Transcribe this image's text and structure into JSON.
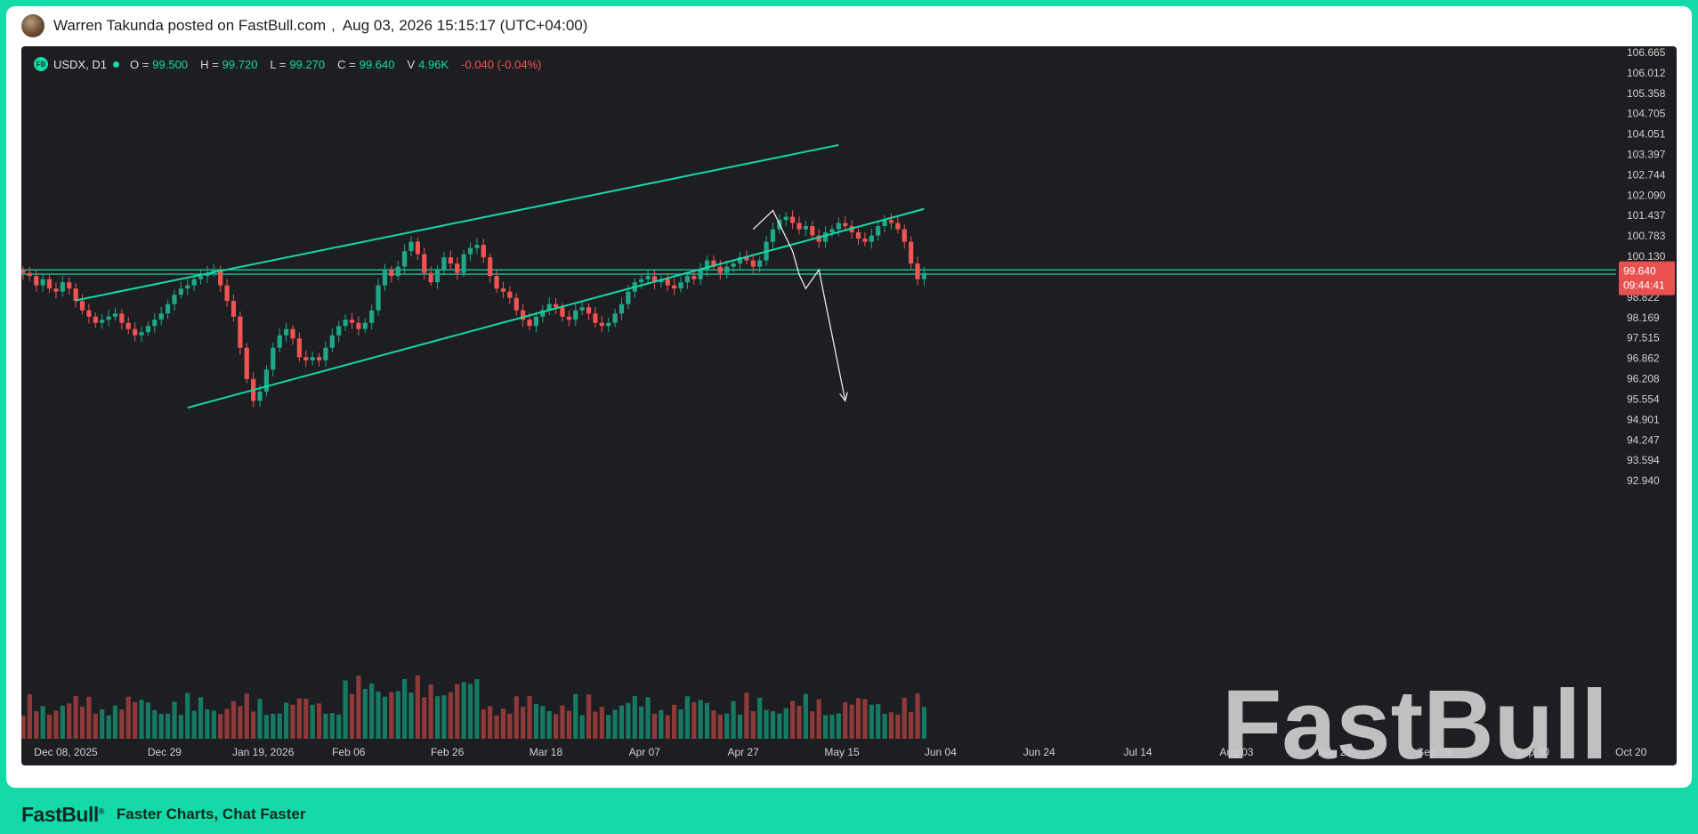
{
  "header": {
    "author": "Warren Takunda posted on FastBull.com",
    "separator": ",",
    "timestamp": "Aug 03, 2026 15:15:17 (UTC+04:00)"
  },
  "legend": {
    "badge": "FB",
    "symbol": "USDX, D1",
    "o_label": "O =",
    "o_value": "99.500",
    "h_label": "H =",
    "h_value": "99.720",
    "l_label": "L =",
    "l_value": "99.270",
    "c_label": "C =",
    "c_value": "99.640",
    "v_label": "V",
    "v_value": "4.96K",
    "change": "-0.040 (-0.04%)"
  },
  "footer": {
    "brand": "FastBull",
    "registered": "®",
    "tagline": "Faster Charts, Chat Faster"
  },
  "watermark": "FastBull",
  "colors": {
    "accent": "#14d9a8",
    "up": "#1fa888",
    "down": "#f05454",
    "background": "#1d1e21"
  },
  "chart_data": {
    "type": "candlestick",
    "title": "USDX, D1",
    "ylim": [
      92.4,
      106.9
    ],
    "y_ticks": [
      "106.665",
      "106.012",
      "105.358",
      "104.705",
      "104.051",
      "103.397",
      "102.744",
      "102.090",
      "101.437",
      "100.783",
      "100.130",
      "98.822",
      "98.169",
      "97.515",
      "96.862",
      "96.208",
      "95.554",
      "94.901",
      "94.247",
      "93.594",
      "92.940"
    ],
    "x_tick_labels": [
      "Dec 08, 2025",
      "Dec 29",
      "Jan 19, 2026",
      "Feb 06",
      "Feb 26",
      "Mar 18",
      "Apr 07",
      "Apr 27",
      "May 15",
      "Jun 04",
      "Jun 24",
      "Jul 14",
      "Aug 03",
      "Aug 21",
      "Sep 10",
      "Sep 30",
      "Oct 20"
    ],
    "x_tick_index": [
      0,
      15,
      30,
      43,
      58,
      73,
      88,
      103,
      118,
      133,
      148,
      163,
      178,
      193,
      208,
      223,
      238
    ],
    "closes": [
      99.6,
      99.5,
      99.2,
      99.4,
      99.1,
      99.0,
      99.3,
      99.1,
      98.7,
      98.4,
      98.2,
      98.0,
      98.1,
      98.2,
      98.3,
      98.0,
      97.8,
      97.6,
      97.7,
      97.9,
      98.1,
      98.3,
      98.6,
      98.9,
      99.1,
      99.2,
      99.4,
      99.5,
      99.6,
      99.7,
      99.2,
      98.7,
      98.2,
      97.2,
      96.2,
      95.5,
      95.8,
      96.5,
      97.2,
      97.6,
      97.8,
      97.5,
      96.9,
      96.8,
      96.9,
      96.8,
      97.2,
      97.6,
      97.9,
      98.1,
      98.0,
      97.8,
      98.0,
      98.4,
      99.2,
      99.7,
      99.5,
      99.8,
      100.3,
      100.6,
      100.2,
      99.6,
      99.3,
      99.7,
      100.1,
      99.9,
      99.6,
      100.2,
      100.4,
      100.5,
      100.1,
      99.5,
      99.1,
      99.0,
      98.8,
      98.4,
      98.1,
      97.9,
      98.2,
      98.4,
      98.6,
      98.5,
      98.2,
      98.1,
      98.4,
      98.5,
      98.3,
      98.0,
      97.9,
      98.0,
      98.3,
      98.6,
      99.0,
      99.3,
      99.4,
      99.5,
      99.3,
      99.4,
      99.2,
      99.1,
      99.3,
      99.5,
      99.4,
      99.7,
      100.0,
      99.8,
      99.6,
      99.8,
      99.9,
      100.1,
      100.0,
      99.8,
      100.0,
      100.6,
      101.0,
      101.3,
      101.4,
      101.2,
      101.0,
      101.1,
      100.8,
      100.6,
      100.9,
      101.0,
      101.2,
      101.1,
      100.9,
      100.7,
      100.6,
      100.8,
      101.1,
      101.3,
      101.2,
      101.0,
      100.6,
      99.9,
      99.4,
      99.6
    ],
    "channel_upper": [
      [
        8,
        98.72
      ],
      [
        90,
        101.6
      ],
      [
        124,
        103.7
      ]
    ],
    "channel_lower": [
      [
        25,
        95.28
      ],
      [
        118,
        100.8
      ],
      [
        137,
        101.65
      ]
    ],
    "horizontal_levels": [
      99.7,
      99.56
    ],
    "projection_path": [
      [
        111,
        101.0
      ],
      [
        114,
        101.6
      ],
      [
        117,
        100.3
      ],
      [
        118,
        99.55
      ],
      [
        119,
        99.1
      ],
      [
        121,
        99.7
      ],
      [
        125,
        95.5
      ]
    ],
    "last_price_label": "99.640",
    "countdown_label": "09:44:41"
  }
}
